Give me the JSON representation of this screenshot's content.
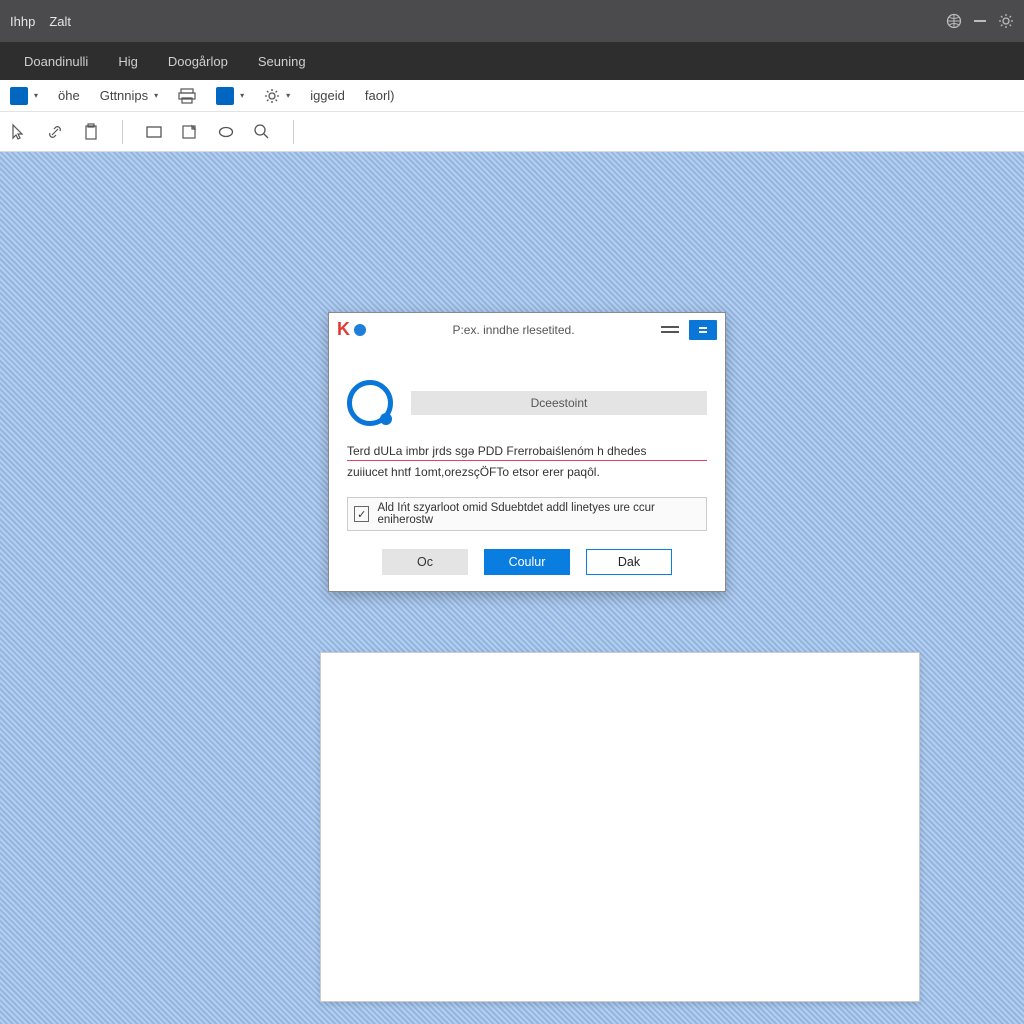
{
  "titlebar": {
    "items": [
      "Ihhp",
      "Zalt"
    ]
  },
  "menubar": {
    "items": [
      "Doandinulli",
      "Hig",
      "Doogårlop",
      "Seuning"
    ]
  },
  "toolbar1": {
    "btn1": "öhe",
    "btn2": "Gttnnips",
    "btn3": "iggeid",
    "btn4": "faorl)"
  },
  "dialog": {
    "title": "P:ex. inndhe rlesetited.",
    "search_label": "Dceestoint",
    "desc1": "Terd dULa imbr jrds sgə PDD Frerrobaiślenóm h dhedes",
    "desc2": "zuiiucet hntf 1omt,orezsçÖFTo etsor erer paqôl.",
    "checkbox_label": "Ald Ińt szyarloot omid Sduebtdet addl linetyes ure ccur eniherostw",
    "checkbox_checked": true,
    "btn_ok": "Oc",
    "btn_continue": "Coulur",
    "btn_dark": "Dak"
  }
}
